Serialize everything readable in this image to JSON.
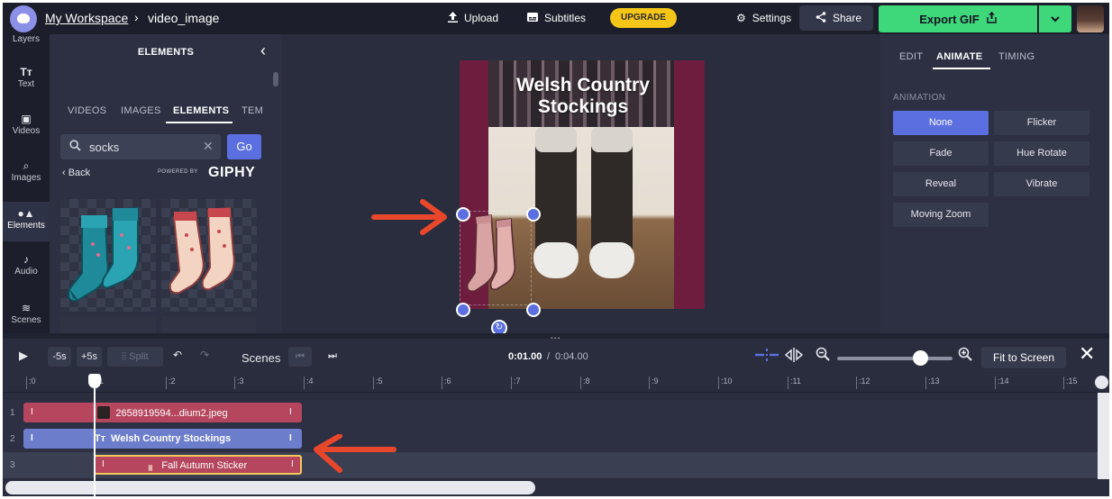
{
  "topbar": {
    "workspace": "My Workspace",
    "separator": "›",
    "filename": "video_image",
    "upload": "Upload",
    "subtitles": "Subtitles",
    "upgrade": "UPGRADE",
    "settings": "Settings",
    "share": "Share",
    "export": "Export GIF"
  },
  "rail": {
    "items": [
      {
        "label": "Layers",
        "icon": "layers-icon"
      },
      {
        "label": "Text",
        "icon": "text-icon"
      },
      {
        "label": "Videos",
        "icon": "video-icon"
      },
      {
        "label": "Images",
        "icon": "images-icon"
      },
      {
        "label": "Elements",
        "icon": "elements-icon"
      },
      {
        "label": "Audio",
        "icon": "music-icon"
      },
      {
        "label": "Scenes",
        "icon": "scenes-icon"
      }
    ],
    "active": "Elements"
  },
  "elements_panel": {
    "title": "ELEMENTS",
    "tabs": [
      "VIDEOS",
      "IMAGES",
      "ELEMENTS",
      "TEM"
    ],
    "active_tab": "ELEMENTS",
    "search": {
      "value": "socks",
      "placeholder": "Search"
    },
    "go": "Go",
    "back": "‹ Back",
    "powered_by": "POWERED BY",
    "giphy": "GIPHY"
  },
  "canvas": {
    "title_line1": "Welsh Country",
    "title_line2": "Stockings",
    "background_color": "#6e1d3e"
  },
  "right_panel": {
    "tabs": [
      "EDIT",
      "ANIMATE",
      "TIMING"
    ],
    "active_tab": "ANIMATE",
    "section_label": "ANIMATION",
    "options": [
      "None",
      "Flicker",
      "Fade",
      "Hue Rotate",
      "Reveal",
      "Vibrate",
      "Moving Zoom"
    ],
    "selected": "None"
  },
  "timeline": {
    "skip_back": "-5s",
    "skip_forward": "+5s",
    "split": "Split",
    "scenes_label": "Scenes",
    "current_time": "0:01.00",
    "time_separator": "/",
    "total_time": "0:04.00",
    "fit_to_screen": "Fit to Screen",
    "zoom_level": 0.72,
    "ruler": [
      ":0",
      "1",
      ":2",
      ":3",
      ":4",
      ":5",
      ":6",
      ":7",
      ":8",
      ":9",
      ":10",
      ":11",
      ":12",
      ":13",
      ":14",
      ":15"
    ],
    "tracks": [
      {
        "number": "1",
        "clip": "2658919594...dium2.jpeg",
        "kind": "image"
      },
      {
        "number": "2",
        "clip": "Welsh Country Stockings",
        "kind": "text"
      },
      {
        "number": "3",
        "clip": "Fall Autumn Sticker",
        "kind": "sticker"
      }
    ],
    "selected_track": "3"
  },
  "colors": {
    "accent": "#5b6fe0",
    "export": "#3ed77a",
    "upgrade": "#f5c518",
    "arrow": "#e8472b",
    "clip_red": "#b5465d",
    "clip_blue": "#6c7dcc"
  }
}
